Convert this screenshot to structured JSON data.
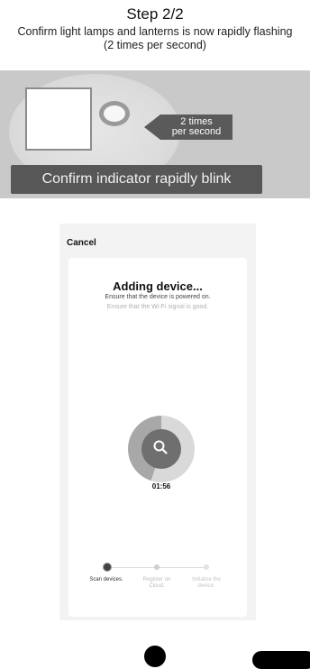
{
  "instruction": {
    "title": "Step 2/2",
    "subtitle_line1": "Confirm light lamps and lanterns is now rapidly flashing",
    "subtitle_line2": "(2 times per second)",
    "rate_line1": "2 times",
    "rate_line2": "per second",
    "indicator_text": "Confirm indicator rapidly blink"
  },
  "phone": {
    "cancel_label": "Cancel",
    "title": "Adding device...",
    "tip_powered": "Ensure that the device is powered on.",
    "tip_wifi": "Ensure that the Wi-Fi signal is good.",
    "timer": "01:56",
    "progress_fraction": 0.45,
    "steps": [
      {
        "label": "Scan devices."
      },
      {
        "label": "Register on Cloud."
      },
      {
        "label": "Initialize the device."
      }
    ]
  },
  "colors": {
    "illustration_bg": "#c9c9c9",
    "banner_bg": "#575757",
    "progress_ring": "#a8a8a8",
    "progress_center": "#6f6f6f"
  },
  "icons": {
    "search": "search-icon",
    "lamp_square": "square-lamp-icon",
    "lamp_ring": "ring-lamp-icon"
  }
}
